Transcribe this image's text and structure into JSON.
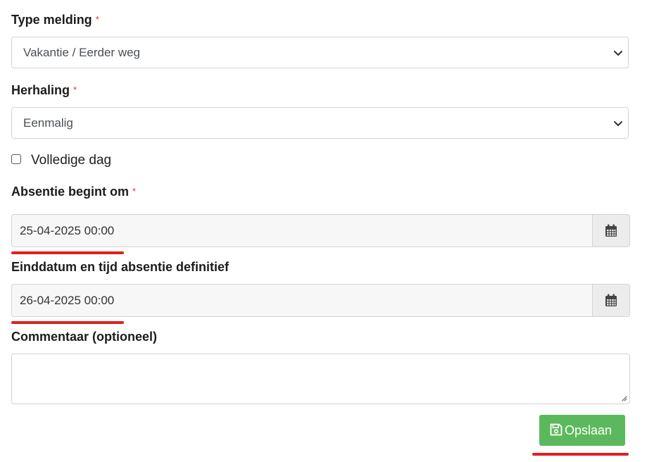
{
  "form": {
    "type_melding": {
      "label": "Type melding",
      "required_mark": "*",
      "value": "Vakantie / Eerder weg"
    },
    "herhaling": {
      "label": "Herhaling",
      "required_mark": "*",
      "value": "Eenmalig"
    },
    "volledige_dag": {
      "label": "Volledige dag",
      "checked": false
    },
    "absentie_begint": {
      "label": "Absentie begint om",
      "required_mark": "*",
      "value": "25-04-2025 00:00"
    },
    "einddatum": {
      "label": "Einddatum en tijd absentie definitief",
      "value": "26-04-2025 00:00"
    },
    "commentaar": {
      "label": "Commentaar (optioneel)",
      "value": ""
    },
    "save_label": "Opslaan"
  },
  "icons": {
    "select_chevron": "chevron-down-icon",
    "date_picker": "calendar-icon",
    "save": "floppy-disk-icon",
    "resize": "resize-grip-icon"
  },
  "colors": {
    "required": "#e03131",
    "save_button": "#5cb85c",
    "annotation_underline": "#e02020"
  }
}
